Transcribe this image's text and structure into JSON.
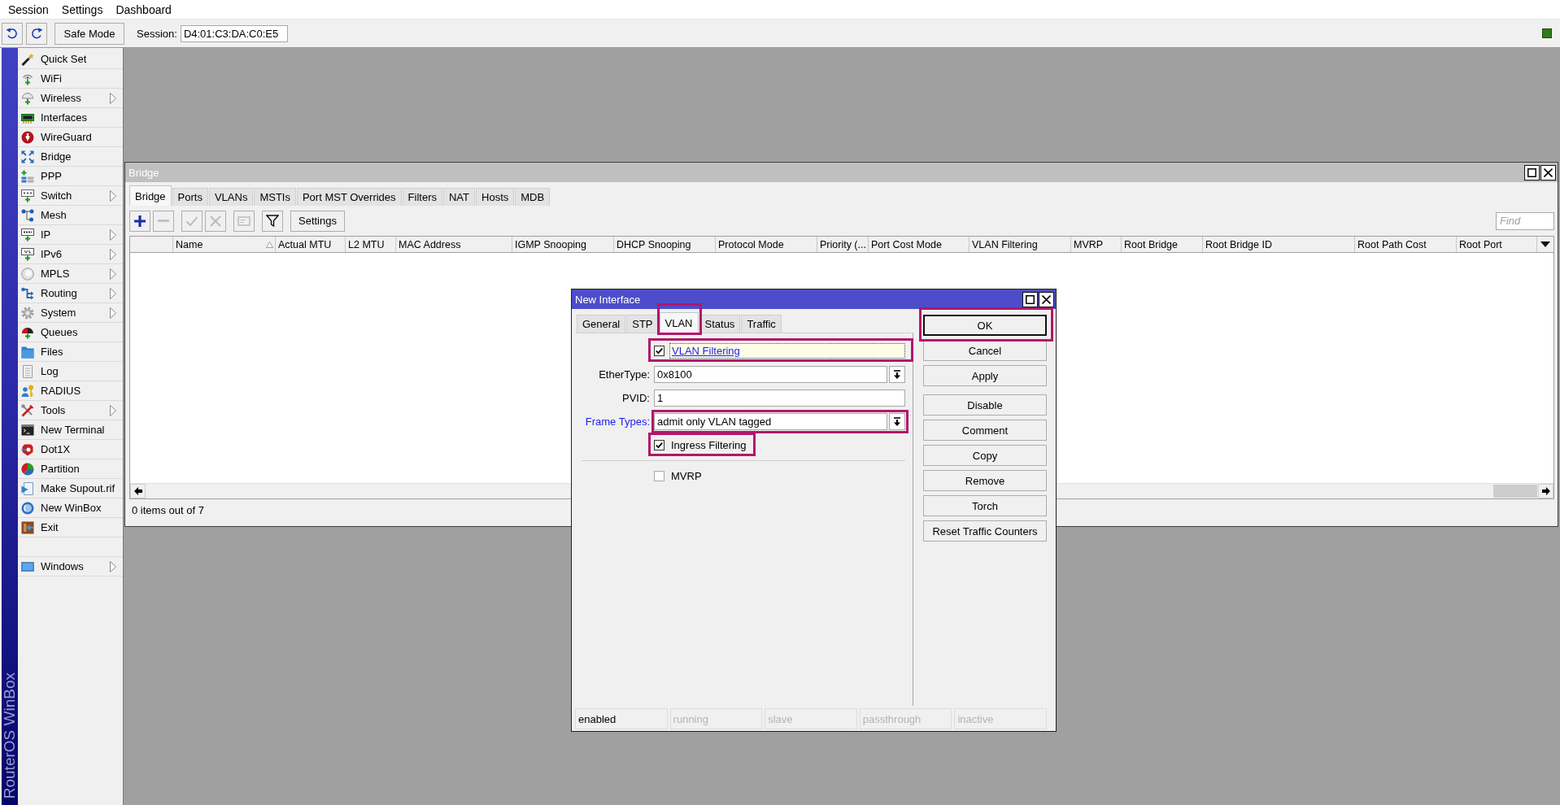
{
  "menu_bar": {
    "items": [
      "Session",
      "Settings",
      "Dashboard"
    ]
  },
  "toolbar": {
    "safe_mode": "Safe Mode",
    "session_label": "Session:",
    "session_value": "D4:01:C3:DA:C0:E5"
  },
  "sidebar": {
    "brand": "RouterOS WinBox",
    "items": [
      {
        "label": "Quick Set",
        "submenu": false
      },
      {
        "label": "WiFi",
        "submenu": false
      },
      {
        "label": "Wireless",
        "submenu": true
      },
      {
        "label": "Interfaces",
        "submenu": false
      },
      {
        "label": "WireGuard",
        "submenu": false
      },
      {
        "label": "Bridge",
        "submenu": false
      },
      {
        "label": "PPP",
        "submenu": false
      },
      {
        "label": "Switch",
        "submenu": true
      },
      {
        "label": "Mesh",
        "submenu": false
      },
      {
        "label": "IP",
        "submenu": true
      },
      {
        "label": "IPv6",
        "submenu": true
      },
      {
        "label": "MPLS",
        "submenu": true
      },
      {
        "label": "Routing",
        "submenu": true
      },
      {
        "label": "System",
        "submenu": true
      },
      {
        "label": "Queues",
        "submenu": false
      },
      {
        "label": "Files",
        "submenu": false
      },
      {
        "label": "Log",
        "submenu": false
      },
      {
        "label": "RADIUS",
        "submenu": false
      },
      {
        "label": "Tools",
        "submenu": true
      },
      {
        "label": "New Terminal",
        "submenu": false
      },
      {
        "label": "Dot1X",
        "submenu": false
      },
      {
        "label": "Partition",
        "submenu": false
      },
      {
        "label": "Make Supout.rif",
        "submenu": false
      },
      {
        "label": "New WinBox",
        "submenu": false
      },
      {
        "label": "Exit",
        "submenu": false
      }
    ],
    "bottom_items": [
      {
        "label": "Windows",
        "submenu": true
      }
    ]
  },
  "bridge_window": {
    "title": "Bridge",
    "active": false,
    "tabs": [
      {
        "label": "Bridge",
        "selected": true
      },
      {
        "label": "Ports",
        "selected": false
      },
      {
        "label": "VLANs",
        "selected": false
      },
      {
        "label": "MSTIs",
        "selected": false
      },
      {
        "label": "Port MST Overrides",
        "selected": false
      },
      {
        "label": "Filters",
        "selected": false
      },
      {
        "label": "NAT",
        "selected": false
      },
      {
        "label": "Hosts",
        "selected": false
      },
      {
        "label": "MDB",
        "selected": false
      }
    ],
    "toolbar_buttons": [
      {
        "kind": "add",
        "disabled": false
      },
      {
        "kind": "remove",
        "disabled": true
      },
      {
        "kind": "enable",
        "disabled": true
      },
      {
        "kind": "disable",
        "disabled": true
      },
      {
        "kind": "comment",
        "disabled": true
      },
      {
        "kind": "filter",
        "disabled": false
      }
    ],
    "settings_button": "Settings",
    "find": {
      "placeholder": "Find"
    },
    "table": {
      "columns": [
        {
          "label": "Name",
          "sorted": true
        },
        {
          "label": "Actual MTU",
          "sorted": false
        },
        {
          "label": "L2 MTU",
          "sorted": false
        },
        {
          "label": "MAC Address",
          "sorted": false
        },
        {
          "label": "IGMP Snooping",
          "sorted": false
        },
        {
          "label": "DHCP Snooping",
          "sorted": false
        },
        {
          "label": "Protocol Mode",
          "sorted": false
        },
        {
          "label": "Priority (...",
          "sorted": false
        },
        {
          "label": "Port Cost Mode",
          "sorted": false
        },
        {
          "label": "VLAN Filtering",
          "sorted": false
        },
        {
          "label": "MVRP",
          "sorted": false
        },
        {
          "label": "Root Bridge",
          "sorted": false
        },
        {
          "label": "Root Bridge ID",
          "sorted": false
        },
        {
          "label": "Root Path Cost",
          "sorted": false
        },
        {
          "label": "Root Port",
          "sorted": false
        }
      ]
    },
    "status": "0 items out of 7"
  },
  "dialog": {
    "title": "New Interface",
    "active": true,
    "tabs": [
      {
        "label": "General",
        "selected": false,
        "highlighted": false
      },
      {
        "label": "STP",
        "selected": false,
        "highlighted": false
      },
      {
        "label": "VLAN",
        "selected": true,
        "highlighted": true
      },
      {
        "label": "Status",
        "selected": false,
        "highlighted": false
      },
      {
        "label": "Traffic",
        "selected": false,
        "highlighted": false
      }
    ],
    "fields": [
      {
        "kind": "checkbox",
        "label": "VLAN Filtering",
        "checked": true,
        "modified": true,
        "focused": true,
        "highlighted": true
      },
      {
        "kind": "dropdown",
        "label": "EtherType:",
        "value": "0x8100",
        "modified": false,
        "highlighted": false
      },
      {
        "kind": "text",
        "label": "PVID:",
        "value": "1",
        "modified": false,
        "highlighted": false
      },
      {
        "kind": "dropdown",
        "label": "Frame Types:",
        "value": "admit only VLAN tagged",
        "modified": true,
        "highlighted": true
      },
      {
        "kind": "checkbox",
        "label": "Ingress Filtering",
        "checked": true,
        "modified": false,
        "focused": false,
        "highlighted": true
      },
      {
        "kind": "separator"
      },
      {
        "kind": "checkbox",
        "label": "MVRP",
        "checked": false,
        "modified": false,
        "focused": false,
        "highlighted": false
      }
    ],
    "button_groups": [
      [
        {
          "label": "OK",
          "default": true,
          "highlighted": true
        },
        {
          "label": "Cancel",
          "default": false,
          "highlighted": false
        },
        {
          "label": "Apply",
          "default": false,
          "highlighted": false
        }
      ],
      [
        {
          "label": "Disable",
          "default": false,
          "highlighted": false
        },
        {
          "label": "Comment",
          "default": false,
          "highlighted": false
        },
        {
          "label": "Copy",
          "default": false,
          "highlighted": false
        },
        {
          "label": "Remove",
          "default": false,
          "highlighted": false
        },
        {
          "label": "Torch",
          "default": false,
          "highlighted": false
        },
        {
          "label": "Reset Traffic Counters",
          "default": false,
          "highlighted": false
        }
      ]
    ],
    "status": [
      {
        "label": "enabled",
        "active": true
      },
      {
        "label": "running",
        "active": false
      },
      {
        "label": "slave",
        "active": false
      },
      {
        "label": "passthrough",
        "active": false
      },
      {
        "label": "inactive",
        "active": false
      }
    ]
  }
}
